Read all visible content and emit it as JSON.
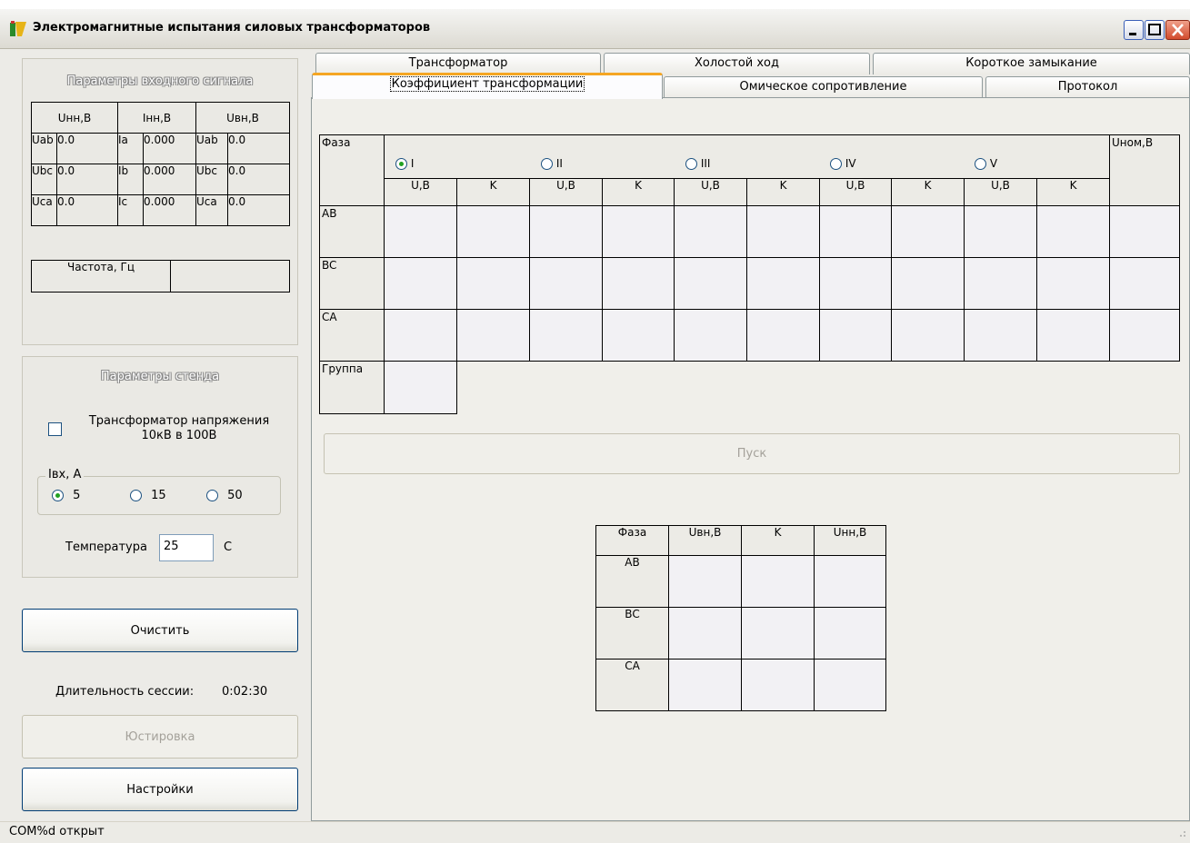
{
  "window": {
    "title": "Электромагнитные испытания силовых трансформаторов"
  },
  "input_signal": {
    "title": "Параметры входного сигнала",
    "headers": [
      "Uнн,В",
      "Iнн,В",
      "Uвн,В"
    ],
    "rows": [
      [
        "Uab",
        "0.0",
        "Ia",
        "0.000",
        "Uab",
        "0.0"
      ],
      [
        "Ubc",
        "0.0",
        "Ib",
        "0.000",
        "Ubc",
        "0.0"
      ],
      [
        "Uca",
        "0.0",
        "Ic",
        "0.000",
        "Uca",
        "0.0"
      ]
    ],
    "freq_label": "Частота, Гц",
    "freq_value": ""
  },
  "stand": {
    "title": "Параметры стенда",
    "checkbox_label_1": "Трансформатор напряжения",
    "checkbox_label_2": "10кВ в 100В",
    "checkbox_checked": false,
    "ibx_label": "Iвх, А",
    "ibx_options": [
      "5",
      "15",
      "50"
    ],
    "ibx_selected": "5",
    "temp_label": "Температура",
    "temp_value": "25",
    "temp_unit": "C"
  },
  "actions": {
    "clear": "Очистить",
    "session_label": "Длительность сессии:",
    "session_value": "0:02:30",
    "calibrate": "Юстировка",
    "settings": "Настройки"
  },
  "tabs": {
    "row1": [
      "Трансформатор",
      "Холостой ход",
      "Короткое замыкание"
    ],
    "row2": [
      "Коэффициент трансформации",
      "Омическое сопротивление",
      "Протокол"
    ],
    "active": "Коэффициент трансформации"
  },
  "ratio_table": {
    "phase_header": "Фаза",
    "taps": [
      "I",
      "II",
      "III",
      "IV",
      "V"
    ],
    "selected_tap": "I",
    "sub_u": "U,B",
    "sub_k": "K",
    "nom_header": "Uном,В",
    "rows": [
      "AB",
      "BC",
      "CA"
    ],
    "group_label": "Группа"
  },
  "start_button": "Пуск",
  "result_table": {
    "headers": [
      "Фаза",
      "Uвн,В",
      "K",
      "Uнн,В"
    ],
    "rows": [
      "AB",
      "BC",
      "CA"
    ]
  },
  "status": {
    "text": "COM%d открыт"
  }
}
